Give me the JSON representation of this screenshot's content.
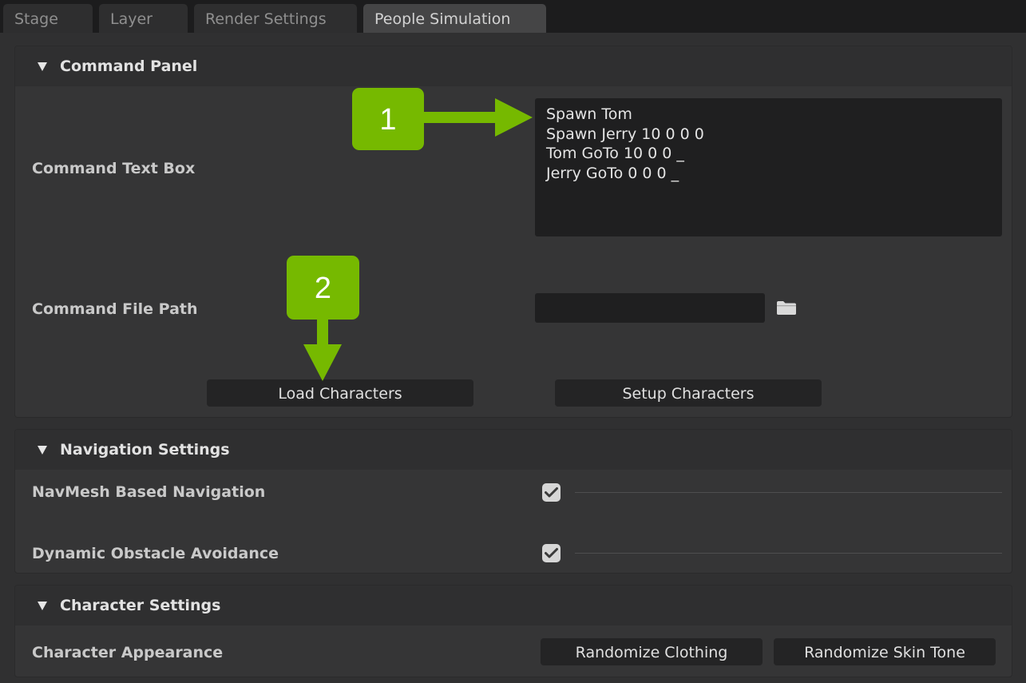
{
  "tabs": [
    {
      "label": "Stage",
      "active": false
    },
    {
      "label": "Layer",
      "active": false
    },
    {
      "label": "Render Settings",
      "active": false
    },
    {
      "label": "People Simulation",
      "active": true
    }
  ],
  "command_panel": {
    "title": "Command Panel",
    "command_text_box_label": "Command Text Box",
    "command_text_lines": [
      "Spawn Tom",
      "Spawn Jerry 10 0 0 0",
      "Tom GoTo 10 0 0 _",
      "Jerry GoTo 0 0 0 _"
    ],
    "command_file_path_label": "Command File Path",
    "command_file_path_value": "",
    "load_button": "Load Characters",
    "setup_button": "Setup Characters"
  },
  "navigation_settings": {
    "title": "Navigation Settings",
    "navmesh_label": "NavMesh Based Navigation",
    "navmesh_checked": true,
    "obstacle_label": "Dynamic Obstacle Avoidance",
    "obstacle_checked": true
  },
  "character_settings": {
    "title": "Character Settings",
    "appearance_label": "Character Appearance",
    "randomize_clothing_button": "Randomize Clothing",
    "randomize_skin_button": "Randomize Skin Tone"
  },
  "annotations": {
    "callout_1": "1",
    "callout_2": "2",
    "accent_color": "#76b900"
  },
  "icons": {
    "collapse": "triangle-down-icon",
    "folder": "folder-icon",
    "check": "checkmark-icon"
  }
}
